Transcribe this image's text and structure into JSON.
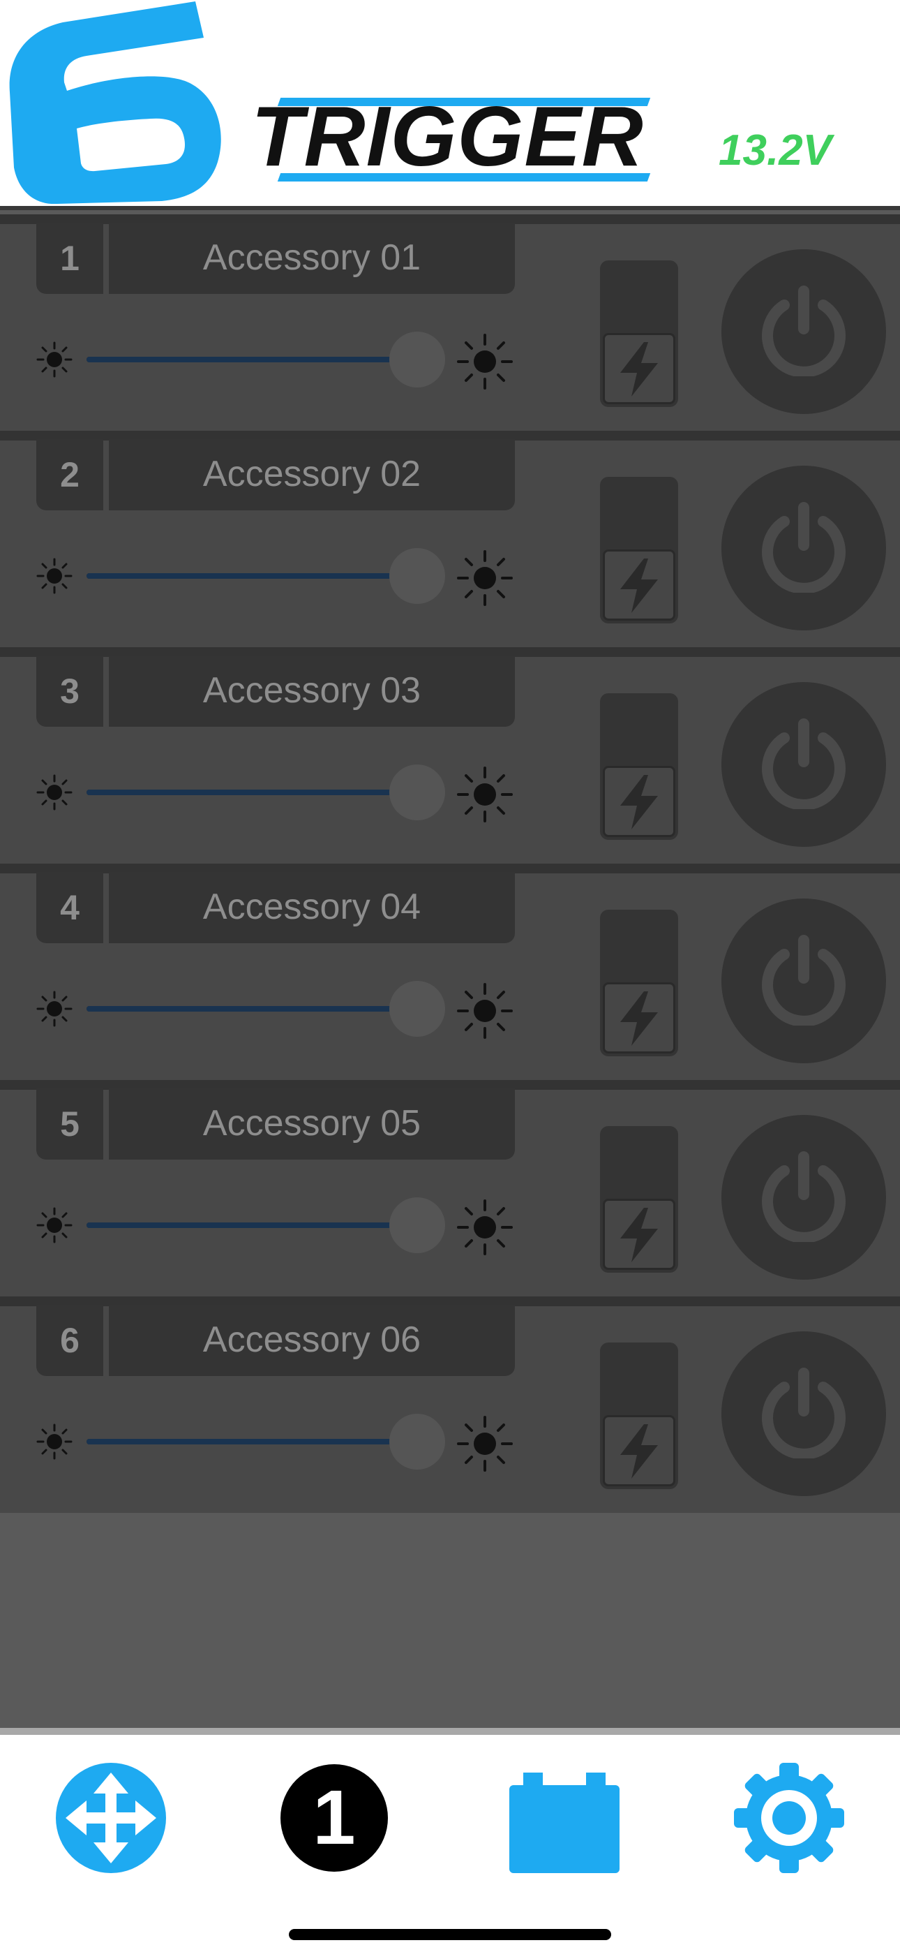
{
  "header": {
    "brand_text": "TRIGGER",
    "voltage": "13.2V",
    "colors": {
      "logo_blue": "#1eaaf1",
      "voltage_green": "#3fcf5c"
    }
  },
  "accessories": [
    {
      "number": "1",
      "name": "Accessory 01",
      "brightness_percent": 100,
      "icons": [
        "sun-small-icon",
        "sun-large-icon",
        "flash-icon",
        "power-icon"
      ]
    },
    {
      "number": "2",
      "name": "Accessory 02",
      "brightness_percent": 100
    },
    {
      "number": "3",
      "name": "Accessory 03",
      "brightness_percent": 100
    },
    {
      "number": "4",
      "name": "Accessory 04",
      "brightness_percent": 100
    },
    {
      "number": "5",
      "name": "Accessory 05",
      "brightness_percent": 100
    },
    {
      "number": "6",
      "name": "Accessory 06",
      "brightness_percent": 100
    }
  ],
  "bottom_nav": {
    "items": [
      {
        "icon": "move-arrows-icon"
      },
      {
        "icon": "profile-number-icon",
        "label": "1"
      },
      {
        "icon": "battery-icon"
      },
      {
        "icon": "gear-icon"
      }
    ],
    "active_color": "#1eaaf1"
  }
}
